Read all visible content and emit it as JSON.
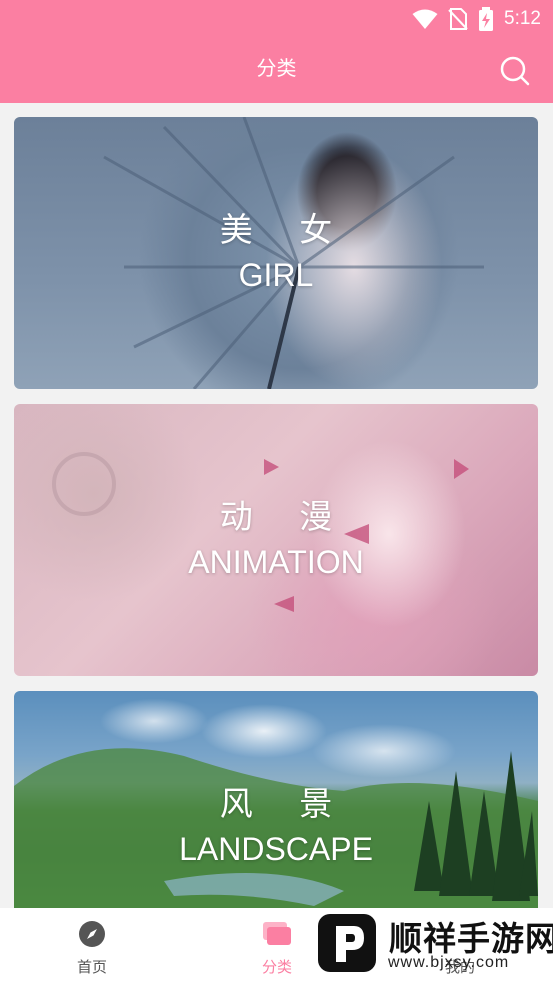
{
  "status_bar": {
    "time": "5:12"
  },
  "header": {
    "title": "分类"
  },
  "categories": [
    {
      "cn": "美 女",
      "en": "GIRL"
    },
    {
      "cn": "动 漫",
      "en": "ANIMATION"
    },
    {
      "cn": "风 景",
      "en": "LANDSCAPE"
    }
  ],
  "bottom_nav": {
    "items": [
      {
        "label": "首页",
        "icon": "compass-icon"
      },
      {
        "label": "分类",
        "icon": "category-cards-icon",
        "active": true
      },
      {
        "label": "我的",
        "icon": "person-icon"
      }
    ]
  },
  "watermark": {
    "cn": "顺祥手游网",
    "en": "www.bjxsy.com"
  },
  "colors": {
    "accent": "#fb7fa2",
    "nav_text": "#555555"
  }
}
